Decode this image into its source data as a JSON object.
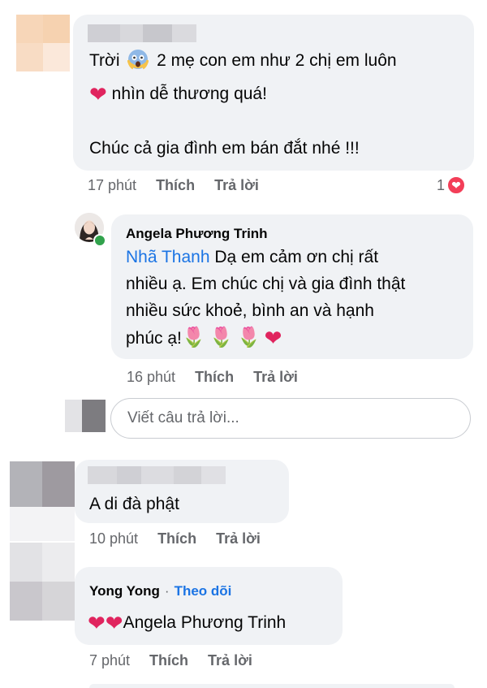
{
  "comment1": {
    "line1": "Trời",
    "line1b": "2 mẹ con em như 2 chị em luôn",
    "line2": "nhìn dễ thương quá!",
    "line3": "Chúc cả gia đình em bán đắt nhé !!!",
    "time": "17 phút",
    "like": "Thích",
    "reply": "Trả lời",
    "reaction_count": "1"
  },
  "reply1": {
    "author": "Angela Phương Trinh",
    "mention": "Nhã Thanh",
    "line1": "Dạ em cảm ơn chị rất",
    "line2": "nhiều ạ. Em chúc chị và gia đình thật",
    "line3": "nhiều sức khoẻ, bình an và hạnh",
    "line4": "phúc ạ!",
    "time": "16 phút",
    "like": "Thích",
    "reply": "Trả lời"
  },
  "reply_box": {
    "placeholder": "Viết câu trả lời..."
  },
  "comment2": {
    "text": "A di đà phật",
    "time": "10 phút",
    "like": "Thích",
    "reply": "Trả lời"
  },
  "comment3": {
    "author": "Yong Yong",
    "separator": "·",
    "follow": "Theo dõi",
    "text": "Angela Phương Trinh",
    "time": "7 phút",
    "like": "Thích",
    "reply": "Trả lời"
  },
  "colors": {
    "bubble": "#f0f2f5",
    "meta": "#65676b",
    "link": "#1b74e4",
    "heart": "#e0245e",
    "online": "#31a24c"
  },
  "icons": [
    "shocked-face-icon",
    "heart-icon",
    "tulip-icon",
    "love-reaction-icon",
    "online-dot-icon"
  ]
}
